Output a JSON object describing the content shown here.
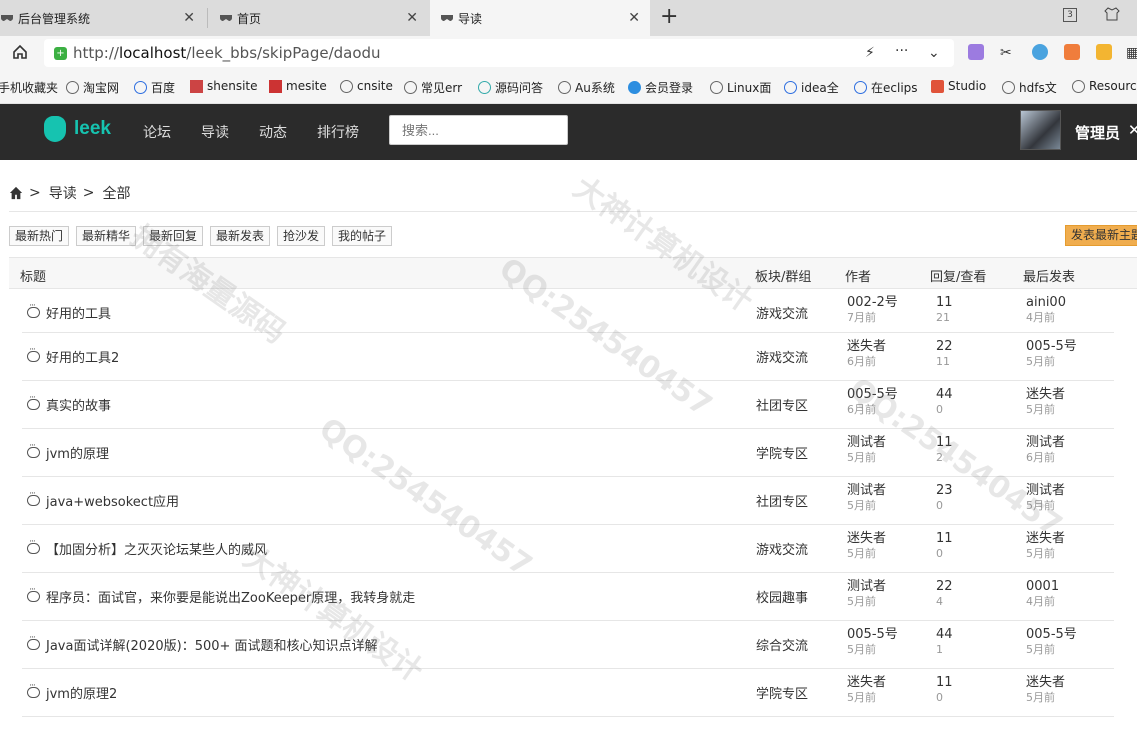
{
  "browser": {
    "tabs": [
      {
        "label": "后台管理系统"
      },
      {
        "label": "首页"
      },
      {
        "label": "导读"
      }
    ],
    "tab_count": "3",
    "url": {
      "prefix": "http://",
      "host": "localhost",
      "path": "/leek_bbs/skipPage/daodu"
    },
    "bookmarks": [
      "手机收藏夹",
      "淘宝网",
      "百度",
      "shensite",
      "mesite",
      "cnsite",
      "常见err",
      "源码问答",
      "Au系统",
      "会员登录",
      "Linux面",
      "idea全",
      "在eclips",
      "Studio",
      "hdfs文",
      "Resource"
    ]
  },
  "site": {
    "logo": "leek",
    "nav": [
      "论坛",
      "导读",
      "动态",
      "排行榜"
    ],
    "search_placeholder": "搜索...",
    "user": "管理员"
  },
  "breadcrumb": {
    "items": [
      "导读",
      "全部"
    ]
  },
  "filters": [
    "最新热门",
    "最新精华",
    "最新回复",
    "最新发表",
    "抢沙发",
    "我的帖子"
  ],
  "post_button": "发表最新主题",
  "table": {
    "headers": {
      "title": "标题",
      "forum": "板块/群组",
      "author": "作者",
      "replies": "回复/查看",
      "last": "最后发表"
    },
    "rows": [
      {
        "title": "好用的工具",
        "forum": "游戏交流",
        "author": "002-2号",
        "author_time": "7月前",
        "replies": "11",
        "views": "21",
        "last_user": "aini00",
        "last_time": "4月前"
      },
      {
        "title": "好用的工具2",
        "forum": "游戏交流",
        "author": "迷失者",
        "author_time": "6月前",
        "replies": "22",
        "views": "11",
        "last_user": "005-5号",
        "last_time": "5月前"
      },
      {
        "title": "真实的故事",
        "forum": "社团专区",
        "author": "005-5号",
        "author_time": "6月前",
        "replies": "44",
        "views": "0",
        "last_user": "迷失者",
        "last_time": "5月前"
      },
      {
        "title": "jvm的原理",
        "forum": "学院专区",
        "author": "测试者",
        "author_time": "5月前",
        "replies": "11",
        "views": "2",
        "last_user": "测试者",
        "last_time": "6月前"
      },
      {
        "title": "java+websokect应用",
        "forum": "社团专区",
        "author": "测试者",
        "author_time": "5月前",
        "replies": "23",
        "views": "0",
        "last_user": "测试者",
        "last_time": "5月前"
      },
      {
        "title": "【加固分析】之灭灭论坛某些人的威风",
        "forum": "游戏交流",
        "author": "迷失者",
        "author_time": "5月前",
        "replies": "11",
        "views": "0",
        "last_user": "迷失者",
        "last_time": "5月前"
      },
      {
        "title": "程序员：面试官，来你要是能说出ZooKeeper原理，我转身就走",
        "forum": "校园趣事",
        "author": "测试者",
        "author_time": "5月前",
        "replies": "22",
        "views": "4",
        "last_user": "0001",
        "last_time": "4月前"
      },
      {
        "title": "Java面试详解(2020版)：500+ 面试题和核心知识点详解",
        "forum": "综合交流",
        "author": "005-5号",
        "author_time": "5月前",
        "replies": "44",
        "views": "1",
        "last_user": "005-5号",
        "last_time": "5月前"
      },
      {
        "title": "jvm的原理2",
        "forum": "学院专区",
        "author": "迷失者",
        "author_time": "5月前",
        "replies": "11",
        "views": "0",
        "last_user": "迷失者",
        "last_time": "5月前"
      }
    ]
  },
  "watermarks": [
    "QQ:254540457",
    "大神计算机设计",
    "拥有海量源码"
  ]
}
